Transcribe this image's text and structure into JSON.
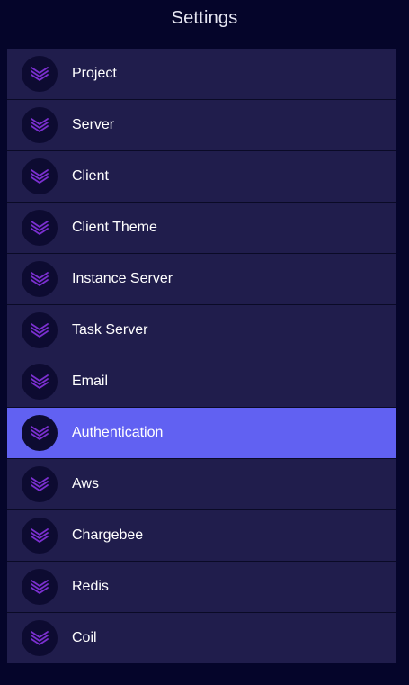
{
  "header": {
    "title": "Settings"
  },
  "colors": {
    "page_background": "#05052a",
    "item_background": "#201d4c",
    "active_background": "#6161f2",
    "icon_circle": "#0d0b31",
    "icon_stroke": "#7b2fd0"
  },
  "menu": {
    "icon": "layers-chevron-icon",
    "active_index": 7,
    "items": [
      {
        "label": "Project"
      },
      {
        "label": "Server"
      },
      {
        "label": "Client"
      },
      {
        "label": "Client Theme"
      },
      {
        "label": "Instance Server"
      },
      {
        "label": "Task Server"
      },
      {
        "label": "Email"
      },
      {
        "label": "Authentication"
      },
      {
        "label": "Aws"
      },
      {
        "label": "Chargebee"
      },
      {
        "label": "Redis"
      },
      {
        "label": "Coil"
      }
    ]
  }
}
